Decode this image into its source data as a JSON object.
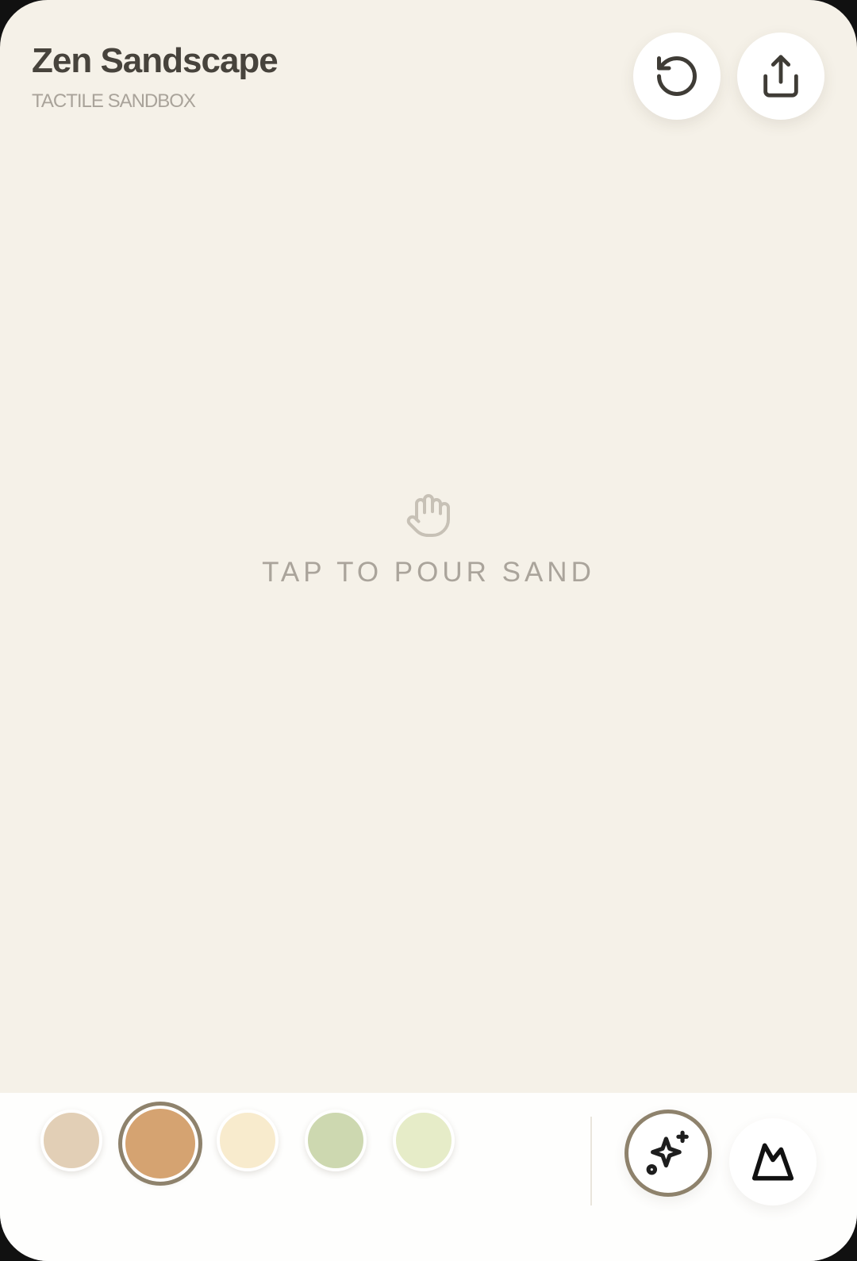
{
  "app": {
    "title": "Zen Sandscape",
    "subtitle": "TACTILE SANDBOX"
  },
  "header": {
    "buttons": [
      {
        "name": "reset",
        "icon": "rotate-ccw-icon"
      },
      {
        "name": "share",
        "icon": "share-icon"
      }
    ]
  },
  "canvas": {
    "hint": "TAP TO POUR SAND",
    "hint_icon": "hand-icon"
  },
  "palette": {
    "swatches": [
      {
        "color": "#e2cfb6",
        "selected": false
      },
      {
        "color": "#d5a371",
        "selected": true
      },
      {
        "color": "#f8ebcd",
        "selected": false
      },
      {
        "color": "#cdd8b0",
        "selected": false
      },
      {
        "color": "#e6ecc8",
        "selected": false
      }
    ],
    "selected_ring_color": "#8e826c"
  },
  "tools": [
    {
      "name": "sparkle",
      "icon": "sparkles-icon",
      "active": true
    },
    {
      "name": "mountain",
      "icon": "mountain-icon",
      "active": false
    }
  ],
  "colors": {
    "background": "#f5f1e8",
    "title_text": "#47433c",
    "muted_text": "#a9a39a",
    "toolbar_bg": "#fefefd"
  }
}
